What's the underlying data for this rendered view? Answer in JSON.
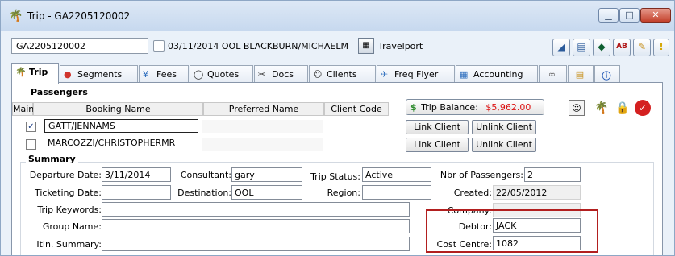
{
  "window": {
    "title": "Trip - GA2205120002",
    "minimize_glyph": "▁",
    "maximize_glyph": "□",
    "close_glyph": "✕"
  },
  "header": {
    "trip_id": "GA2205120002",
    "description": "03/11/2014 OOL BLACKBURN/MICHAELM",
    "provider": "Travelport",
    "toolbar_icons": [
      "chart-icon",
      "document-icon",
      "shield-icon",
      "spellcheck-icon",
      "pencil-icon",
      "warning-icon"
    ]
  },
  "tabs": [
    {
      "label": "Trip",
      "icon": "palm-tree-icon"
    },
    {
      "label": "Segments",
      "icon": "segments-icon"
    },
    {
      "label": "Fees",
      "icon": "fees-icon"
    },
    {
      "label": "Quotes",
      "icon": "speech-bubble-icon"
    },
    {
      "label": "Docs",
      "icon": "docs-icon"
    },
    {
      "label": "Clients",
      "icon": "clients-icon"
    },
    {
      "label": "Freq Flyer",
      "icon": "freq-flyer-icon"
    },
    {
      "label": "Accounting",
      "icon": "accounting-icon"
    },
    {
      "label": "",
      "icon": "link-icon"
    },
    {
      "label": "",
      "icon": "notes-icon"
    },
    {
      "label": "",
      "icon": "info-icon"
    }
  ],
  "passengers": {
    "title": "Passengers",
    "columns": [
      "Main",
      "Booking Name",
      "Preferred Name",
      "Client Code"
    ],
    "rows": [
      {
        "checked": true,
        "booking_name": "GATT/JENNAMS",
        "preferred_name": "",
        "client_code": ""
      },
      {
        "checked": false,
        "booking_name": "MARCOZZI/CHRISTOPHERMR",
        "preferred_name": "",
        "client_code": ""
      }
    ],
    "trip_balance_label": "Trip Balance:",
    "trip_balance_value": "$5,962.00",
    "link_client_label": "Link Client",
    "unlink_client_label": "Unlink Client"
  },
  "summary": {
    "title": "Summary",
    "departure_date_label": "Departure Date:",
    "departure_date": "3/11/2014",
    "consultant_label": "Consultant:",
    "consultant": "gary",
    "trip_status_label": "Trip Status:",
    "trip_status": "Active",
    "nbr_passengers_label": "Nbr of Passengers:",
    "nbr_passengers": "2",
    "ticketing_date_label": "Ticketing Date:",
    "ticketing_date": "",
    "destination_label": "Destination:",
    "destination": "OOL",
    "region_label": "Region:",
    "region": "",
    "created_label": "Created:",
    "created": "22/05/2012",
    "trip_keywords_label": "Trip Keywords:",
    "trip_keywords": "",
    "company_label": "Company:",
    "company": "",
    "group_name_label": "Group Name:",
    "group_name": "",
    "debtor_label": "Debtor:",
    "debtor": "JACK",
    "itin_summary_label": "Itin. Summary:",
    "itin_summary": "",
    "cost_centre_label": "Cost Centre:",
    "cost_centre": "1082"
  },
  "colors": {
    "balance_amount": "#dd1111",
    "highlight_border": "#b21f1f"
  }
}
